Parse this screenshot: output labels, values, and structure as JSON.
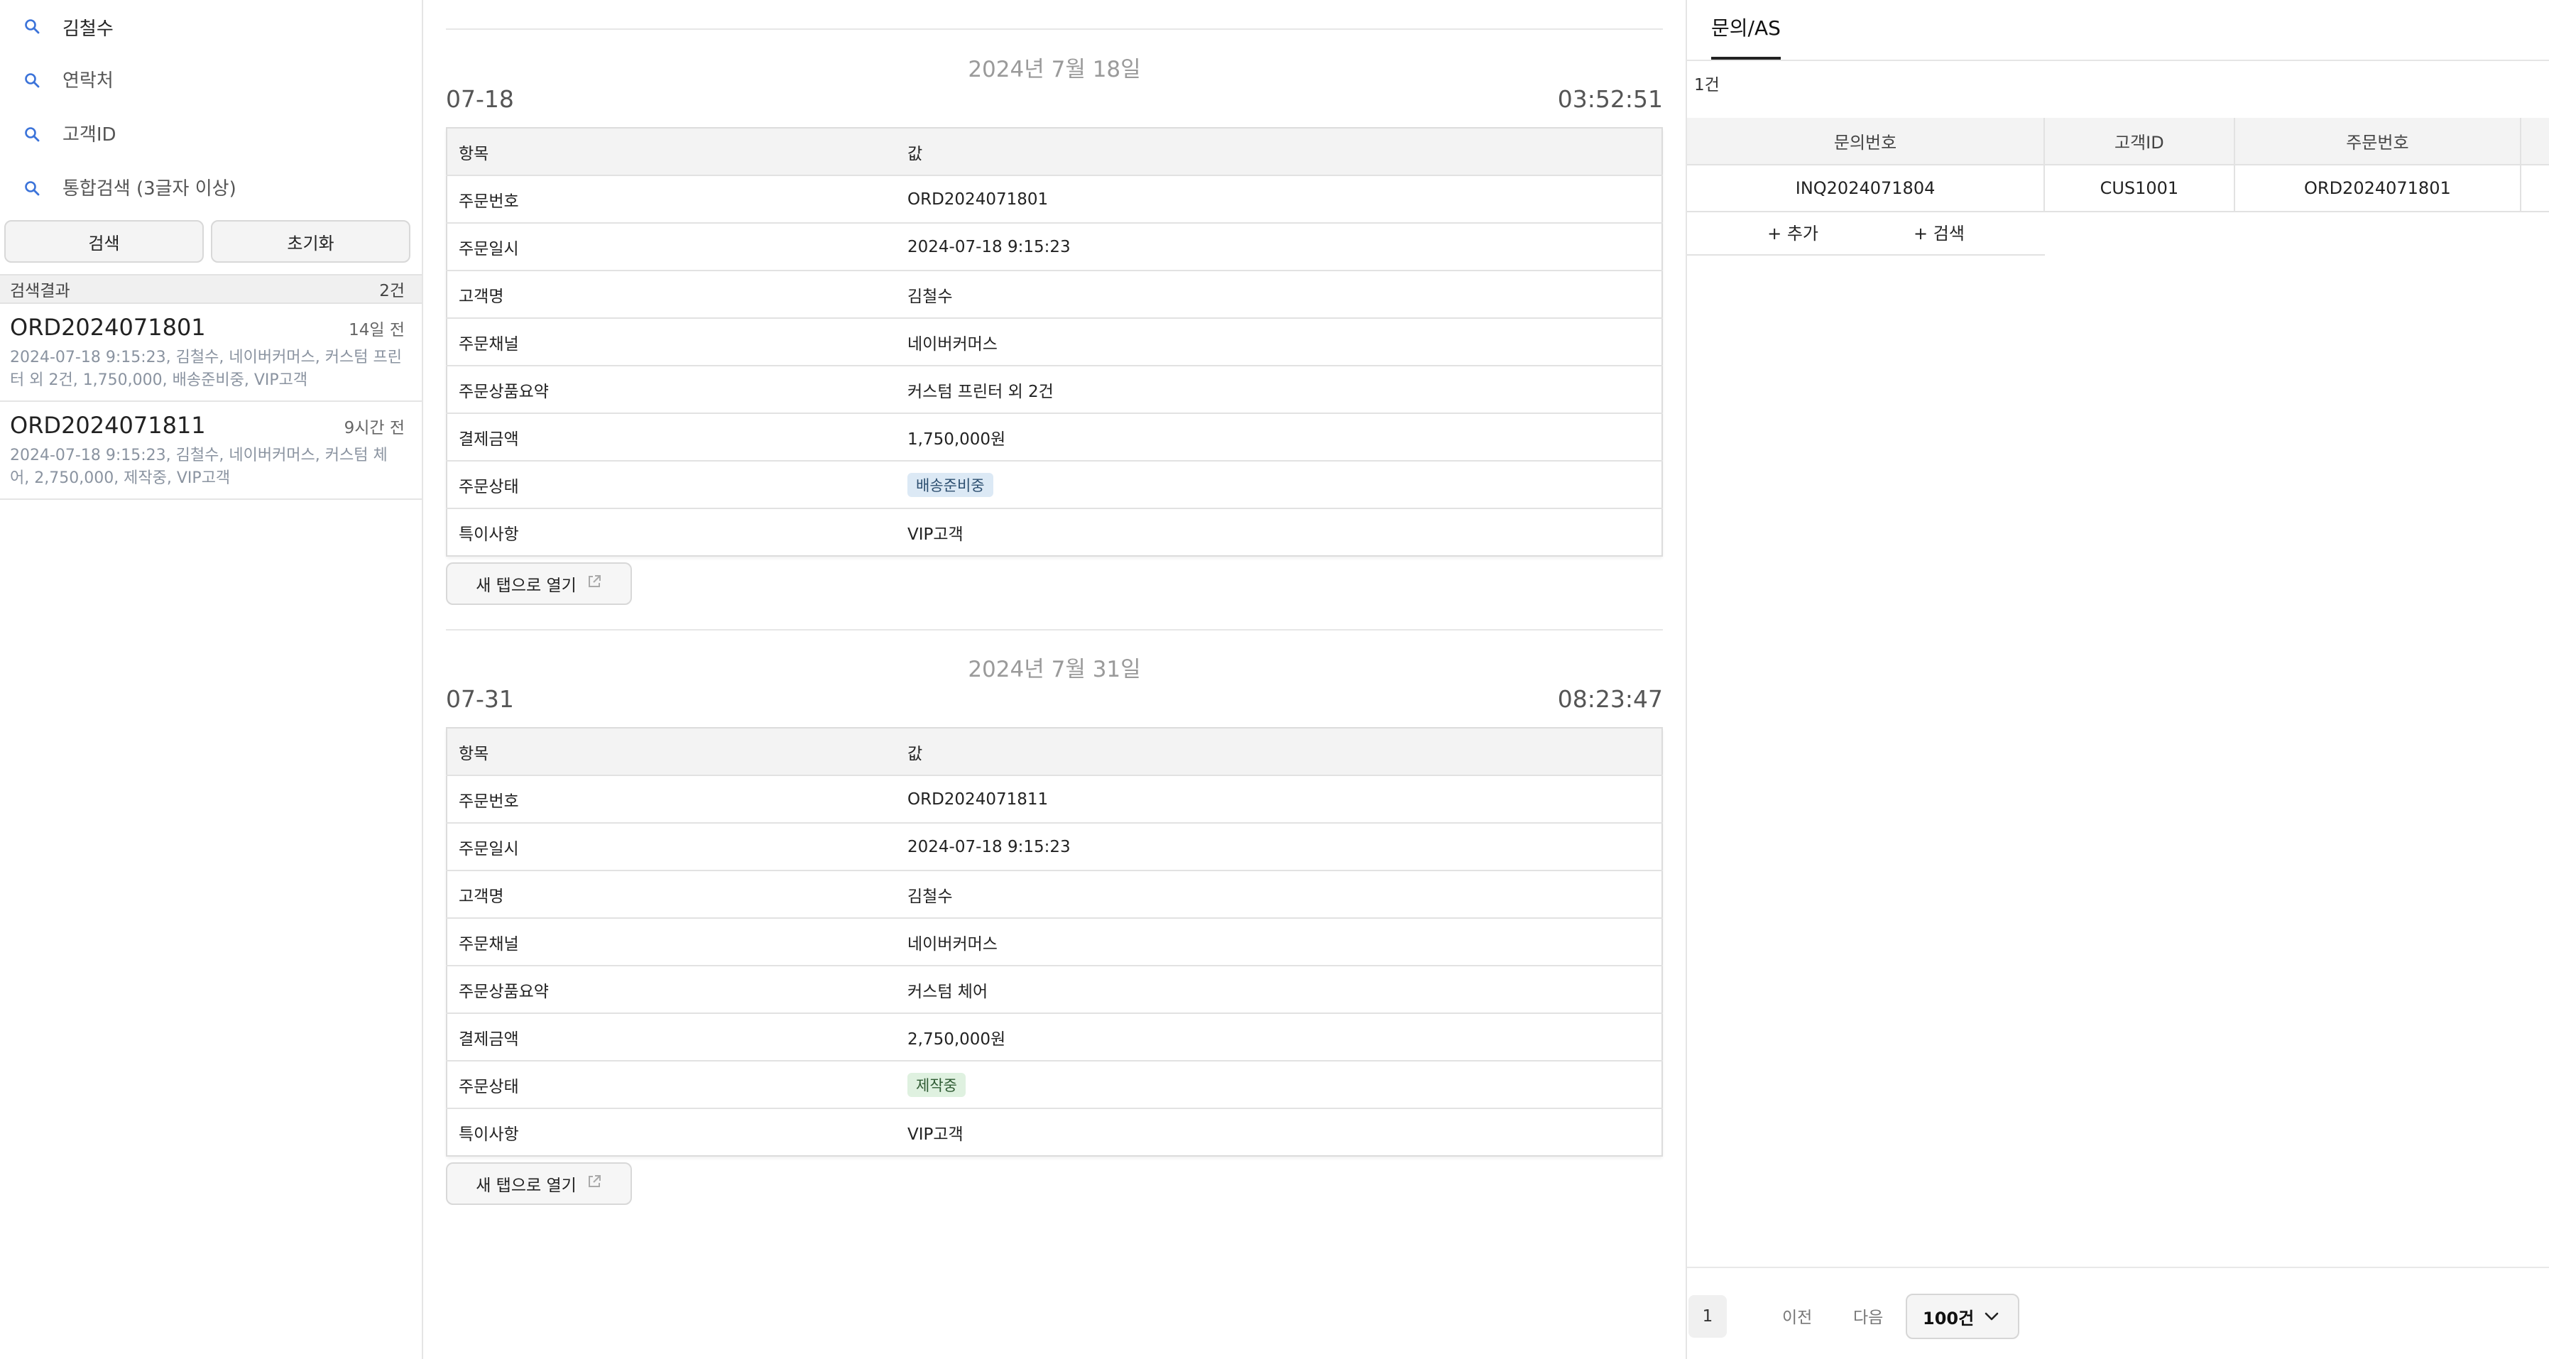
{
  "search": {
    "fields": [
      {
        "value": "김철수",
        "placeholder": ""
      },
      {
        "value": "",
        "placeholder": "연락처"
      },
      {
        "value": "",
        "placeholder": "고객ID"
      },
      {
        "value": "",
        "placeholder": "통합검색 (3글자 이상)"
      }
    ],
    "search_button": "검색",
    "reset_button": "초기화"
  },
  "results": {
    "header_label": "검색결과",
    "count": "2건",
    "items": [
      {
        "order": "ORD2024071801",
        "ago": "14일 전",
        "desc": "2024-07-18 9:15:23, 김철수, 네이버커머스, 커스텀 프린터 외 2건, 1,750,000, 배송준비중, VIP고객"
      },
      {
        "order": "ORD2024071811",
        "ago": "9시간 전",
        "desc": "2024-07-18 9:15:23, 김철수, 네이버커머스, 커스텀 체어, 2,750,000, 제작중, VIP고객"
      }
    ]
  },
  "details": [
    {
      "date_title": "2024년 7월 18일",
      "short_date": "07-18",
      "time": "03:52:51",
      "header": [
        "항목",
        "값"
      ],
      "rows": [
        {
          "label": "주문번호",
          "value": "ORD2024071801"
        },
        {
          "label": "주문일시",
          "value": "2024-07-18 9:15:23"
        },
        {
          "label": "고객명",
          "value": "김철수"
        },
        {
          "label": "주문채널",
          "value": "네이버커머스"
        },
        {
          "label": "주문상품요약",
          "value": "커스텀 프린터 외 2건"
        },
        {
          "label": "결제금액",
          "value": "1,750,000원"
        },
        {
          "label": "주문상태",
          "value": "배송준비중"
        },
        {
          "label": "특이사항",
          "value": "VIP고객"
        }
      ],
      "status_color": "#dce9f5",
      "open_button": "새 탭으로 열기"
    },
    {
      "date_title": "2024년 7월 31일",
      "short_date": "07-31",
      "time": "08:23:47",
      "header": [
        "항목",
        "값"
      ],
      "rows": [
        {
          "label": "주문번호",
          "value": "ORD2024071811"
        },
        {
          "label": "주문일시",
          "value": "2024-07-18 9:15:23"
        },
        {
          "label": "고객명",
          "value": "김철수"
        },
        {
          "label": "주문채널",
          "value": "네이버커머스"
        },
        {
          "label": "주문상품요약",
          "value": "커스텀 체어"
        },
        {
          "label": "결제금액",
          "value": "2,750,000원"
        },
        {
          "label": "주문상태",
          "value": "제작중"
        },
        {
          "label": "특이사항",
          "value": "VIP고객"
        }
      ],
      "status_color": "#dff1e0",
      "open_button": "새 탭으로 열기"
    }
  ],
  "inquiry": {
    "tab_label": "문의/AS",
    "count": "1건",
    "columns": [
      "문의번호",
      "고객ID",
      "주문번호"
    ],
    "rows": [
      [
        "INQ2024071804",
        "CUS1001",
        "ORD2024071801"
      ]
    ],
    "add_label": "+ 추가",
    "search_label": "+ 검색",
    "pager": {
      "page": "1",
      "prev": "이전",
      "next": "다음",
      "per_page": "100건"
    }
  }
}
